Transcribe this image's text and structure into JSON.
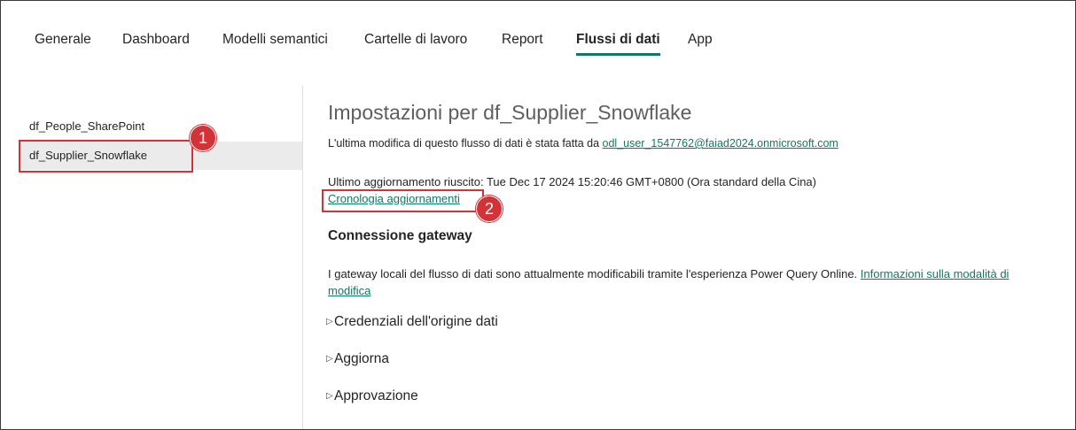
{
  "tabs": [
    {
      "label": "Generale",
      "active": false
    },
    {
      "label": "Dashboard",
      "active": false
    },
    {
      "label": "Modelli semantici",
      "active": false
    },
    {
      "label": "Cartelle di lavoro",
      "active": false
    },
    {
      "label": "Report",
      "active": false
    },
    {
      "label": "Flussi di dati",
      "active": true
    },
    {
      "label": "App",
      "active": false
    }
  ],
  "sidebar": {
    "items": [
      {
        "label": "df_People_SharePoint"
      },
      {
        "label": "df_Supplier_Snowflake",
        "selected": true
      }
    ]
  },
  "callouts": {
    "one": "1",
    "two": "2"
  },
  "main": {
    "title": "Impostazioni per df_Supplier_Snowflake",
    "last_modified_prefix": "L'ultima modifica di questo flusso di dati è stata fatta da",
    "last_modified_user": "odl_user_1547762@faiad2024.onmicrosoft.com",
    "last_refresh": "Ultimo aggiornamento riuscito: Tue Dec 17 2024 15:20:46 GMT+0800 (Ora standard della Cina)",
    "history_link": "Cronologia aggiornamenti",
    "gateway_heading": "Connessione gateway",
    "gateway_text": "I gateway locali del flusso di dati sono attualmente modificabili tramite l'esperienza Power Query Online.",
    "gateway_link": "Informazioni sulla modalità di modifica",
    "expanders": [
      {
        "label": "Credenziali dell'origine dati"
      },
      {
        "label": "Aggiorna"
      },
      {
        "label": "Approvazione"
      }
    ]
  },
  "colors": {
    "accent": "#117865",
    "callout": "#d13438",
    "selected_bg": "#ebebeb"
  }
}
